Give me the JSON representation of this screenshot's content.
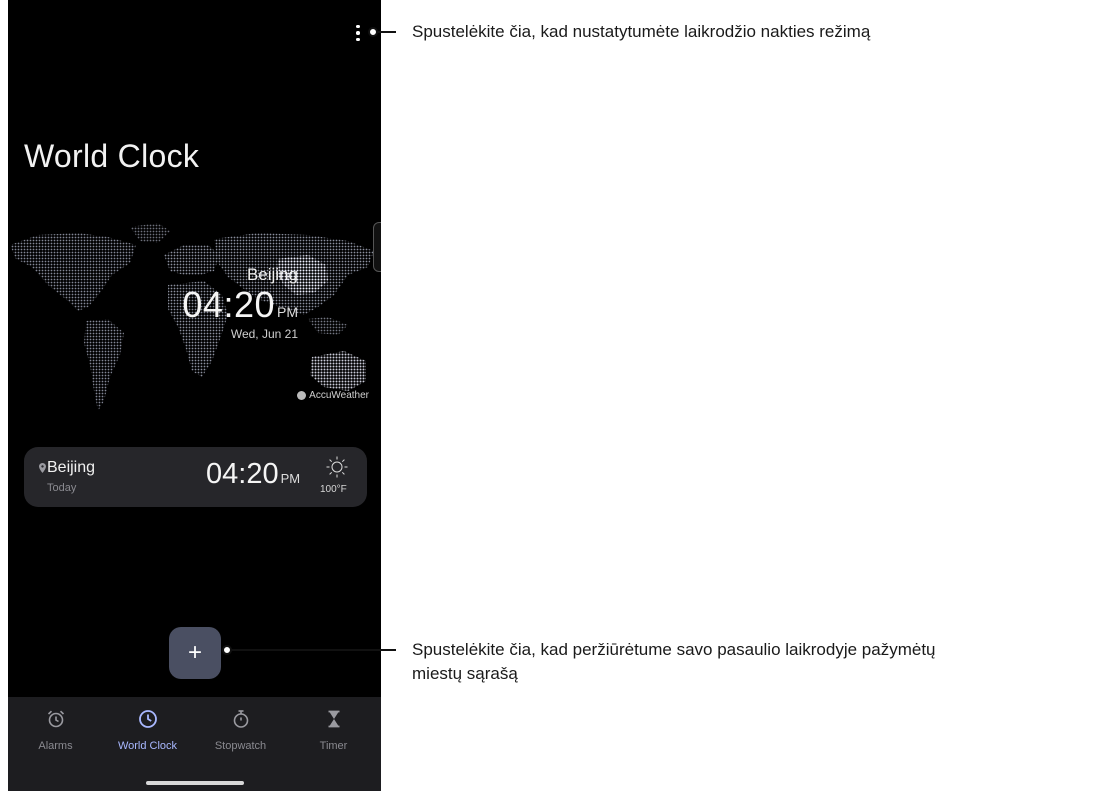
{
  "screen": {
    "title": "World Clock",
    "menu_icon": "overflow-menu-icon"
  },
  "map": {
    "city": "Beijing",
    "time": "04:20",
    "ampm": "PM",
    "date": "Wed, Jun 21",
    "provider": "AccuWeather"
  },
  "city_card": {
    "name": "Beijing",
    "day": "Today",
    "time": "04:20",
    "ampm": "PM",
    "temperature": "100°F",
    "weather_icon": "sunny-icon"
  },
  "add_button": {
    "label": "+"
  },
  "nav": {
    "items": [
      {
        "label": "Alarms",
        "icon": "alarm-icon",
        "active": false
      },
      {
        "label": "World Clock",
        "icon": "clock-icon",
        "active": true
      },
      {
        "label": "Stopwatch",
        "icon": "stopwatch-icon",
        "active": false
      },
      {
        "label": "Timer",
        "icon": "hourglass-icon",
        "active": false
      }
    ]
  },
  "callouts": {
    "menu": "Spustelėkite čia, kad nustatytumėte laikrodžio nakties režimą",
    "add_line1": "Spustelėkite čia, kad peržiūrėtume savo pasaulio laikrodyje pažymėtų",
    "add_line2": "miestų sąrašą"
  },
  "colors": {
    "background": "#000000",
    "card": "#26262a",
    "accent": "#a9b8ff",
    "nav_bg": "#1d1d20",
    "add_button": "#4a4f62"
  }
}
